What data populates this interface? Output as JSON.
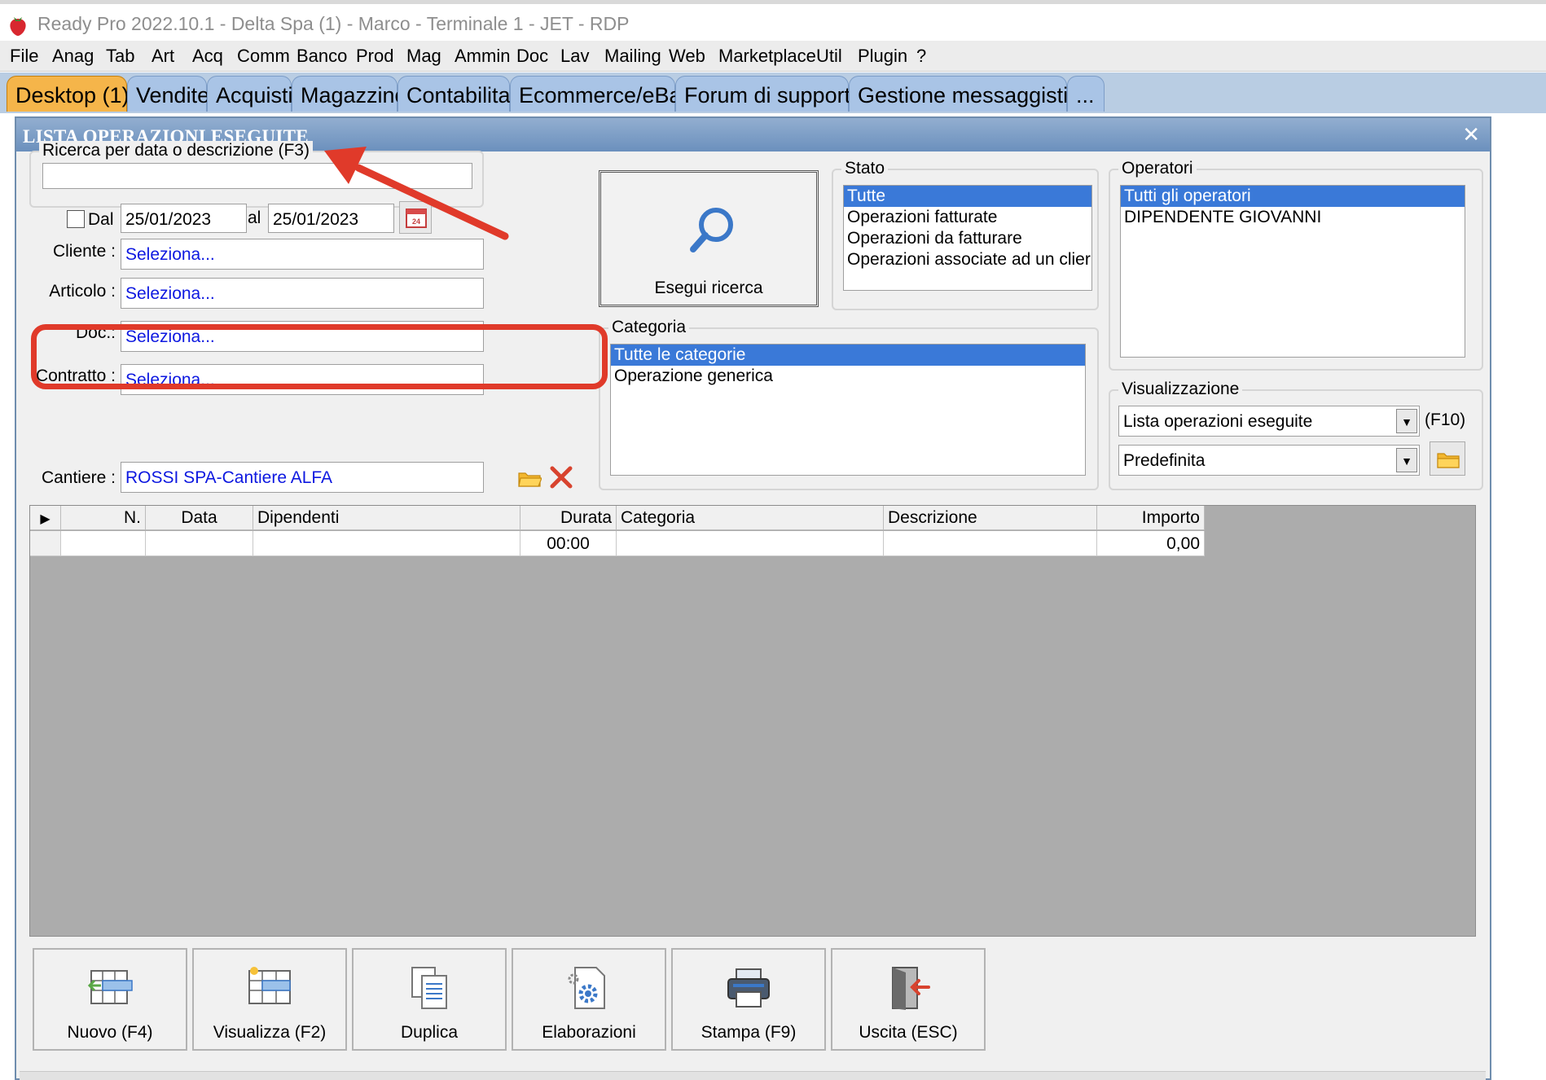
{
  "window": {
    "title": "Ready Pro 2022.10.1 - Delta Spa (1) - Marco - Terminale 1 - JET - RDP"
  },
  "menubar": {
    "items": [
      "File",
      "Anag",
      "Tab",
      "Art",
      "Acq",
      "Comm",
      "Banco",
      "Prod",
      "Mag",
      "Ammin",
      "Doc",
      "Lav",
      "Mailing",
      "Web",
      "Marketplace",
      "Util",
      "Plugin",
      "?"
    ]
  },
  "tabs": [
    {
      "label": "Desktop (1)",
      "active": true
    },
    {
      "label": "Vendite",
      "active": false
    },
    {
      "label": "Acquisti",
      "active": false
    },
    {
      "label": "Magazzino",
      "active": false
    },
    {
      "label": "Contabilita'",
      "active": false
    },
    {
      "label": "Ecommerce/eBay",
      "active": false
    },
    {
      "label": "Forum di supporto",
      "active": false
    },
    {
      "label": "Gestione messaggistica",
      "active": false
    },
    {
      "label": "...",
      "active": false
    }
  ],
  "dialog": {
    "title": "LISTA OPERAZIONI ESEGUITE",
    "search": {
      "legend": "Ricerca per data o descrizione (F3)",
      "value": ""
    },
    "date_filter": {
      "checkbox_label": "Dal",
      "checked": false,
      "from": "25/01/2023",
      "to_label": "al",
      "to": "25/01/2023",
      "calendar_badge": "24"
    },
    "fields": {
      "cliente": {
        "label": "Cliente :",
        "value": "Seleziona..."
      },
      "articolo": {
        "label": "Articolo :",
        "value": "Seleziona..."
      },
      "doc": {
        "label": "Doc.:",
        "value": "Seleziona..."
      },
      "contratto": {
        "label": "Contratto :",
        "value": "Seleziona..."
      },
      "cantiere": {
        "label": "Cantiere :",
        "value": "ROSSI SPA-Cantiere ALFA"
      }
    },
    "search_button": {
      "label": "Esegui ricerca"
    },
    "stato": {
      "legend": "Stato",
      "items": [
        "Tutte",
        "Operazioni fatturate",
        "Operazioni da fatturare",
        "Operazioni associate ad un clier"
      ],
      "selected": 0
    },
    "operatori": {
      "legend": "Operatori",
      "items": [
        "Tutti gli operatori",
        "DIPENDENTE GIOVANNI"
      ],
      "selected": 0
    },
    "categoria": {
      "legend": "Categoria",
      "items": [
        "Tutte le categorie",
        "Operazione generica"
      ],
      "selected": 0
    },
    "visualizzazione": {
      "legend": "Visualizzazione",
      "view_select": "Lista operazioni eseguite",
      "view_shortcut": "(F10)",
      "layout_select": "Predefinita"
    },
    "grid": {
      "columns": [
        "N.",
        "Data",
        "Dipendenti",
        "Durata",
        "Categoria",
        "Descrizione",
        "Importo"
      ],
      "rows": [
        [
          "",
          "",
          "",
          "00:00",
          "",
          "",
          "0,00"
        ]
      ]
    },
    "buttons": [
      {
        "label": "Nuovo (F4)",
        "icon": "new-table-icon"
      },
      {
        "label": "Visualizza (F2)",
        "icon": "view-table-icon"
      },
      {
        "label": "Duplica",
        "icon": "duplicate-doc-icon"
      },
      {
        "label": "Elaborazioni",
        "icon": "gear-doc-icon"
      },
      {
        "label": "Stampa (F9)",
        "icon": "printer-icon"
      },
      {
        "label": "Uscita (ESC)",
        "icon": "exit-door-icon"
      }
    ]
  },
  "colors": {
    "tab_active": "#f5b54a",
    "tab_inactive": "#a9c4e6",
    "selection": "#3a79d8",
    "link_text": "#0d18e0",
    "annotation": "#e03a2a"
  }
}
